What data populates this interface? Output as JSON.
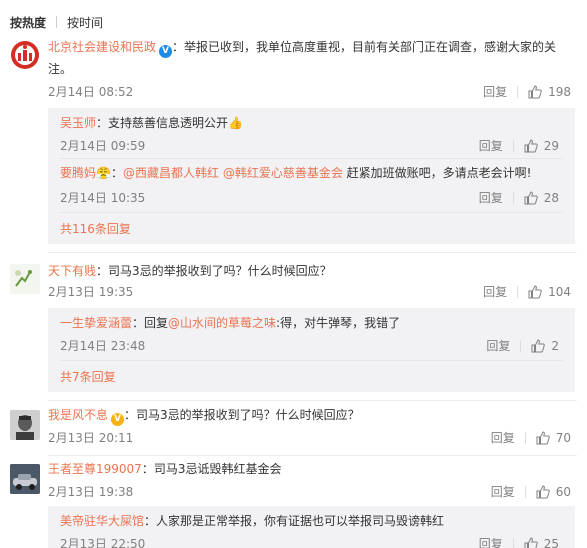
{
  "tabs": {
    "hot": "按热度",
    "time": "按时间"
  },
  "common": {
    "reply": "回复"
  },
  "c1": {
    "user": "北京社会建设和民政",
    "text": "：举报已收到，我单位高度重视，目前有关部门正在调查，感谢大家的关注。",
    "time": "2月14日 08:52",
    "likes": "198",
    "replies": [
      {
        "user": "吴玉师",
        "text": "：支持慈善信息透明公开👍",
        "time": "2月14日 09:59",
        "likes": "29"
      },
      {
        "user": "要腾妈",
        "emoji": "😤",
        "sep": "：",
        "mention1": "@西藏昌都人韩红",
        "mention2": "@韩红爱心慈善基金会",
        "text": " 赶紧加班做账吧，多请点老会计啊!",
        "time": "2月14日 10:35",
        "likes": "28"
      }
    ],
    "more": "共116条回复"
  },
  "c2": {
    "user": "天下有贱",
    "text": "：司马3忌的举报收到了吗？什么时候回应？",
    "time": "2月13日 19:35",
    "likes": "104",
    "replies": [
      {
        "user": "一生挚爱涵蕾",
        "pre": "：回复",
        "mention": "@山水间的草莓之味",
        "text": ":得，对牛弹琴，我错了",
        "time": "2月14日 23:48",
        "likes": "2"
      }
    ],
    "more": "共7条回复"
  },
  "c3": {
    "user": "我是风不息",
    "text": "：司马3忌的举报收到了吗？什么时候回应？",
    "time": "2月13日 20:11",
    "likes": "70"
  },
  "c4": {
    "user": "王者至尊199007",
    "text": "：司马3忌诋毁韩红基金会",
    "time": "2月13日 19:38",
    "likes": "60",
    "replies": [
      {
        "user": "美帝驻华大屎馆",
        "text": "：人家那是正常举报，你有证据也可以举报司马毁谤韩红",
        "time": "2月13日 22:50",
        "likes": "25"
      }
    ]
  },
  "colors": {
    "accent": "#eb7350",
    "verified_blue": "#1e8ce6",
    "verified_gold": "#f5b316",
    "reply_bg": "#f2f2f5",
    "meta_gray": "#808080"
  },
  "icons": {
    "like": "thumbs-up-icon",
    "verified": "verified-v-icon"
  }
}
